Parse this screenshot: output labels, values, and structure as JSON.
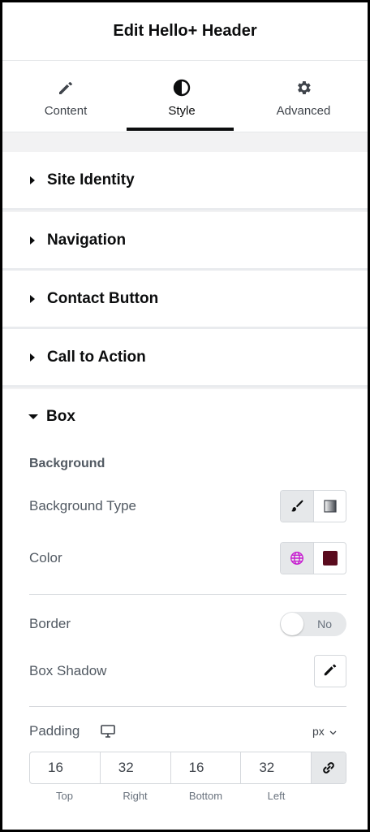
{
  "header": {
    "title": "Edit Hello+ Header"
  },
  "tabs": [
    {
      "label": "Content",
      "icon": "pencil-icon",
      "active": false
    },
    {
      "label": "Style",
      "icon": "half-circle-icon",
      "active": true
    },
    {
      "label": "Advanced",
      "icon": "gear-icon",
      "active": false
    }
  ],
  "sections": [
    {
      "label": "Site Identity",
      "expanded": false
    },
    {
      "label": "Navigation",
      "expanded": false
    },
    {
      "label": "Contact Button",
      "expanded": false
    },
    {
      "label": "Call to Action",
      "expanded": false
    },
    {
      "label": "Box",
      "expanded": true
    }
  ],
  "box": {
    "background_heading": "Background",
    "background_type_label": "Background Type",
    "color_label": "Color",
    "color_value": "#5a0b1e",
    "border_label": "Border",
    "border_toggle": "No",
    "box_shadow_label": "Box Shadow",
    "padding_label": "Padding",
    "padding_unit": "px",
    "padding": [
      {
        "value": "16",
        "label": "Top"
      },
      {
        "value": "32",
        "label": "Right"
      },
      {
        "value": "16",
        "label": "Bottom"
      },
      {
        "value": "32",
        "label": "Left"
      }
    ]
  },
  "colors": {
    "accent_global": "#c71ed0",
    "text": "#0c0d0e",
    "muted": "#515962"
  }
}
